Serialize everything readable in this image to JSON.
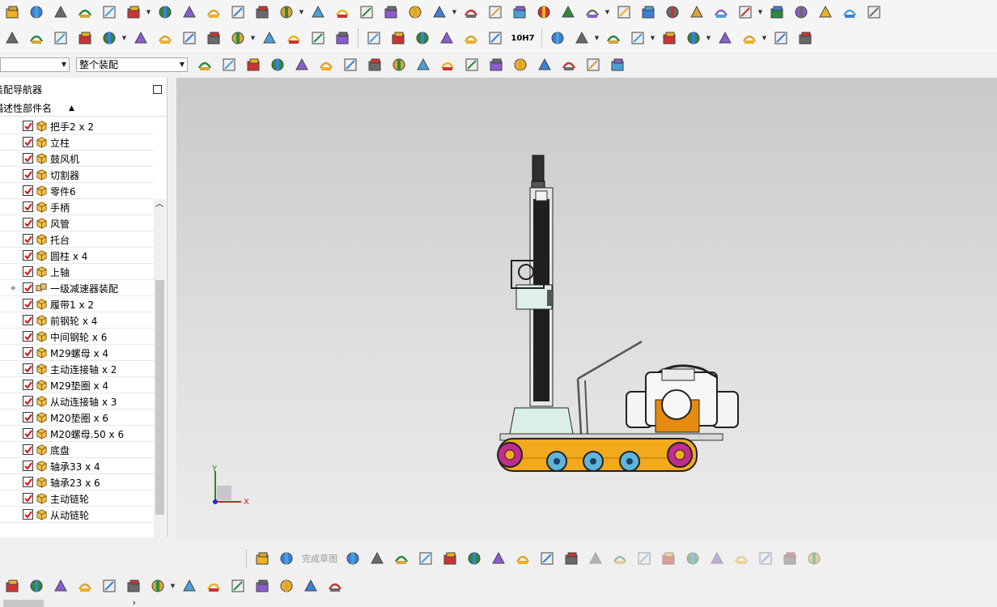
{
  "toolbar": {
    "row1_icons": [
      "extrude-icon",
      "revolve-icon",
      "block-icon",
      "cylinder-icon",
      "edge-blend-icon",
      "chamfer-icon",
      "pattern-icon",
      "hole-icon",
      "boss-icon",
      "unite-icon",
      "move-face-icon",
      "offset-face-icon",
      "trim-body-icon",
      "split-body-icon",
      "shell-icon",
      "draft-icon",
      "datum-plane-icon",
      "datum-axis-icon",
      "thicken-icon",
      "swept-icon",
      "sew-icon",
      "patch-icon",
      "through-curves-icon",
      "mesh-surface-icon",
      "n-sided-surface-icon",
      "offset-surface-icon",
      "styled-sweep-icon",
      "bridge-icon",
      "law-extension-icon",
      "ruled-icon",
      "extension-icon",
      "boolean-icon",
      "intersect-icon",
      "subtract-icon",
      "emboss-icon"
    ],
    "row2_icons": [
      "layer-settings-icon",
      "move-layer-icon",
      "copy-layer-icon",
      "assembly-constraint-icon",
      "reposition-icon",
      "mate-icon",
      "text-icon",
      "spline-icon",
      "surface-icon",
      "point-icon",
      "threads-icon",
      "spring-icon",
      "gear-icon",
      "weld-icon",
      "triangle-icon",
      "table-icon",
      "symbol-icon",
      "centerline-icon",
      "note-icon",
      "brush-icon",
      "tolerance-icon",
      "add-component-icon",
      "new-component-icon",
      "line-icon",
      "arc-icon",
      "studio-spline-icon",
      "fillet-icon",
      "offset-curve-icon",
      "project-curve-icon",
      "mirror-curve-icon",
      "trim-curve-icon"
    ],
    "tolerance_label": "10H7",
    "filter_select": "",
    "assembly_select": "整个装配",
    "row3_icons": [
      "snap-icon",
      "select-icon",
      "move-icon",
      "rotate-icon",
      "box-select-icon",
      "view-icon",
      "cube-icon",
      "point-snap-icon",
      "end-point-icon",
      "mid-point-icon",
      "control-point-icon",
      "intersection-icon",
      "center-icon",
      "quadrant-icon",
      "existing-point-icon",
      "point-on-curve-icon",
      "point-on-face-icon",
      "grid-icon"
    ]
  },
  "navigator": {
    "title": "装配导航器",
    "column_header": "描述性部件名",
    "items": [
      {
        "label": "把手2 x 2",
        "checked": true,
        "expand": false
      },
      {
        "label": "立柱",
        "checked": true,
        "expand": false
      },
      {
        "label": "鼓风机",
        "checked": true,
        "expand": false
      },
      {
        "label": "切割器",
        "checked": true,
        "expand": false
      },
      {
        "label": "零件6",
        "checked": true,
        "expand": false
      },
      {
        "label": "手柄",
        "checked": true,
        "expand": false
      },
      {
        "label": "风管",
        "checked": true,
        "expand": false
      },
      {
        "label": "托台",
        "checked": true,
        "expand": false
      },
      {
        "label": "圆柱 x 4",
        "checked": true,
        "expand": false
      },
      {
        "label": "上轴",
        "checked": true,
        "expand": false
      },
      {
        "label": "一级减速器装配",
        "checked": true,
        "expand": true
      },
      {
        "label": "履带1 x 2",
        "checked": true,
        "expand": false
      },
      {
        "label": "前钢轮 x 4",
        "checked": true,
        "expand": false
      },
      {
        "label": "中间钢轮 x 6",
        "checked": true,
        "expand": false
      },
      {
        "label": "M29螺母 x 4",
        "checked": true,
        "expand": false
      },
      {
        "label": "主动连接轴 x 2",
        "checked": true,
        "expand": false
      },
      {
        "label": "M29垫圈 x 4",
        "checked": true,
        "expand": false
      },
      {
        "label": "从动连接轴 x 3",
        "checked": true,
        "expand": false
      },
      {
        "label": "M20垫圈 x 6",
        "checked": true,
        "expand": false
      },
      {
        "label": "M20螺母.50 x 6",
        "checked": true,
        "expand": false
      },
      {
        "label": "底盘",
        "checked": true,
        "expand": false
      },
      {
        "label": "轴承33 x 4",
        "checked": true,
        "expand": false
      },
      {
        "label": "轴承23 x 6",
        "checked": true,
        "expand": false
      },
      {
        "label": "主动链轮",
        "checked": true,
        "expand": false
      },
      {
        "label": "从动链轮",
        "checked": true,
        "expand": false
      }
    ]
  },
  "sketch_toolbar": {
    "finish_label": "完成草图"
  },
  "triad": {
    "x": "X",
    "y": "Y"
  },
  "colors": {
    "track": "#f2a91c",
    "wheel_blue": "#5fb5d9",
    "wheel_magenta": "#c22c8f",
    "gearbox": "#e58b10",
    "mast": "#2b2b2b",
    "base": "#dcefe6"
  }
}
